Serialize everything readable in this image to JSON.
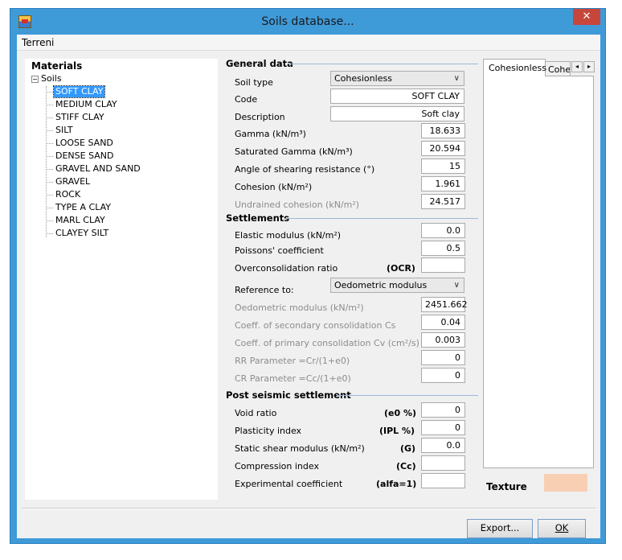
{
  "window": {
    "title": "Soils database...",
    "close_label": "✕"
  },
  "menu": {
    "items": [
      "Terreni"
    ]
  },
  "tree": {
    "header": "Materials",
    "root_toggle": "−",
    "root": "Soils",
    "items": [
      "SOFT CLAY",
      "MEDIUM CLAY",
      "STIFF CLAY",
      "SILT",
      "LOOSE SAND",
      "DENSE SAND",
      "GRAVEL AND SAND",
      "GRAVEL",
      "ROCK",
      "TYPE A CLAY",
      "MARL CLAY",
      "CLAYEY SILT"
    ],
    "selected": "SOFT CLAY"
  },
  "general": {
    "title": "General data",
    "soil_type_label": "Soil type",
    "soil_type_value": "Cohesionless",
    "code_label": "Code",
    "code_value": "SOFT CLAY",
    "description_label": "Description",
    "description_value": "Soft clay",
    "gamma_label": "Gamma (kN/m³)",
    "gamma_value": "18.633",
    "sat_gamma_label": "Saturated Gamma (kN/m³)",
    "sat_gamma_value": "20.594",
    "friction_label": "Angle of shearing resistance (°)",
    "friction_value": "15",
    "cohesion_label": "Cohesion (kN/m²)",
    "cohesion_value": "1.961",
    "undrained_label": "Undrained cohesion (kN/m²)",
    "undrained_value": "24.517"
  },
  "settlements": {
    "title": "Settlements",
    "elastic_label": "Elastic modulus (kN/m²)",
    "elastic_value": "0.0",
    "poisson_label": "Poissons' coefficient",
    "poisson_value": "0.5",
    "ocr_label": "Overconsolidation ratio",
    "ocr_tag": "(OCR)",
    "ocr_value": "",
    "reference_label": "Reference to:",
    "reference_value": "Oedometric modulus",
    "oedometric_label": "Oedometric modulus (kN/m²)",
    "oedometric_value": "2451.662",
    "cs_label": "Coeff. of secondary consolidation Cs",
    "cs_value": "0.04",
    "cv_label": "Coeff. of primary consolidation Cv (cm²/s)",
    "cv_value": "0.003",
    "rr_label": "RR Parameter =Cr/(1+e0)",
    "rr_value": "0",
    "cr_label": "CR Parameter =Cc/(1+e0)",
    "cr_value": "0"
  },
  "seismic": {
    "title": "Post seismic settlement",
    "void_label": "Void ratio",
    "void_tag": "(e0 %)",
    "void_value": "0",
    "plasticity_label": "Plasticity index",
    "plasticity_tag": "(IPL %)",
    "plasticity_value": "0",
    "shear_label": "Static shear modulus (kN/m²)",
    "shear_tag": "(G)",
    "shear_value": "0.0",
    "compression_label": "Compression index",
    "compression_tag": "(Cc)",
    "compression_value": "",
    "experimental_label": "Experimental coefficient",
    "experimental_tag": "(alfa=1)",
    "experimental_value": ""
  },
  "tabs": {
    "tab1": "Cohesionless",
    "tab2": "Cohesive",
    "left_arrow": "◂",
    "right_arrow": "▸"
  },
  "texture": {
    "label": "Texture",
    "color": "#f9cfb4"
  },
  "buttons": {
    "export": "Export...",
    "ok": "OK"
  },
  "colors": {
    "title_bar": "#3f9ad8",
    "close": "#c7463b",
    "selection": "#3399ff"
  }
}
